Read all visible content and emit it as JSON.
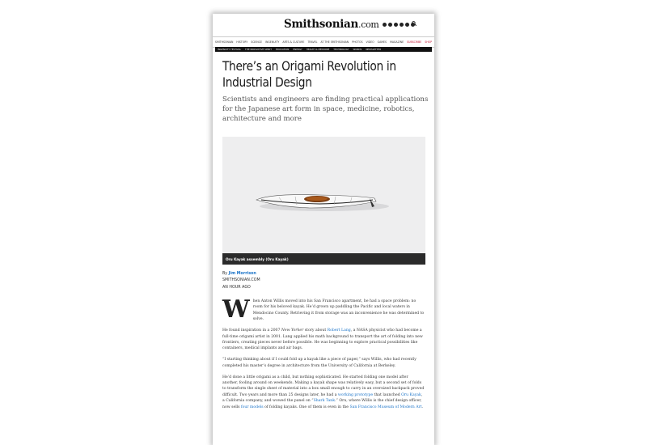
{
  "site": {
    "logo_main": "Smithsonian",
    "logo_tld": ".com"
  },
  "social_icons": [
    "facebook-icon",
    "twitter-icon",
    "pinterest-icon",
    "instagram-icon",
    "youtube-icon",
    "rss-icon"
  ],
  "nav_primary": [
    "Smithsonian",
    "History",
    "Science",
    "Ingenuity",
    "Arts & Culture",
    "Travel",
    "At the Smithsonian",
    "Photos",
    "Video",
    "Games",
    "Magazine",
    "Subscribe",
    "Shop"
  ],
  "nav_secondary": [
    "Ingenuity Festival",
    "The Innovative Spirit",
    "Education",
    "Energy",
    "Health & Medicine",
    "Technology",
    "Words",
    "Newsletter"
  ],
  "article": {
    "title": "There’s an Origami Revolution in Industrial Design",
    "dek": "Scientists and engineers are finding practical applications for the Japanese art form in space, medicine, robotics, architecture and more",
    "caption": "Oru Kayak assembly (Oru Kayak)",
    "byline_prefix": "By ",
    "author": "Jim Morrison",
    "outlet": "SMITHSONIAN.COM",
    "time": "AN HOUR AGO",
    "dropcap": "W",
    "p1": "hen Anton Willis moved into his San Francisco apartment, he had a space problem: no room for his beloved kayak. He’d grown up paddling the Pacific and local waters in Mendocino County. Retrieving it from storage was an inconvenience he was determined to solve.",
    "p2_a": "He found inspiration in a 2007 ",
    "p2_mag": "New Yorker",
    "p2_b": " story about ",
    "p2_link": "Robert Lang",
    "p2_c": ", a NASA physicist who had become a full-time origami artist in 2001. Lang applied his math background to transport the art of folding into new frontiers, creating pieces never before possible. He was beginning to explore practical possibilities like containers, medical implants and air bags.",
    "p3": "“I starting thinking about if I could fold up a kayak like a piece of paper,” says Willis, who had recently completed his master’s degree in architecture from the University of California at Berkeley.",
    "p4_a": "He’d done a little origami as a child, but nothing sophisticated. He started folding one model after another, fooling around on weekends. Making a kayak shape was relatively easy, but a second set of folds to transform the single sheet of material into a box small enough to carry in an oversized backpack proved difficult. Two years and more than 25 designs later, he had a ",
    "p4_link1": "working prototype",
    "p4_b": " that launched ",
    "p4_link2": "Oru Kayak",
    "p4_c": ", a California company, and wowed the panel on “",
    "p4_link3": "Shark Tank",
    "p4_d": ".” Oru, where Willis is the chief design officer, now sells ",
    "p4_link4": "four models",
    "p4_e": " of folding kayaks. One of them is even in the ",
    "p4_link5": "San Francisco Museum of Modern Art",
    "p4_f": "."
  },
  "colors": {
    "accent_link": "#1a73c8",
    "subscribe": "#c4122f",
    "caption_bg": "#2b2b2b"
  }
}
